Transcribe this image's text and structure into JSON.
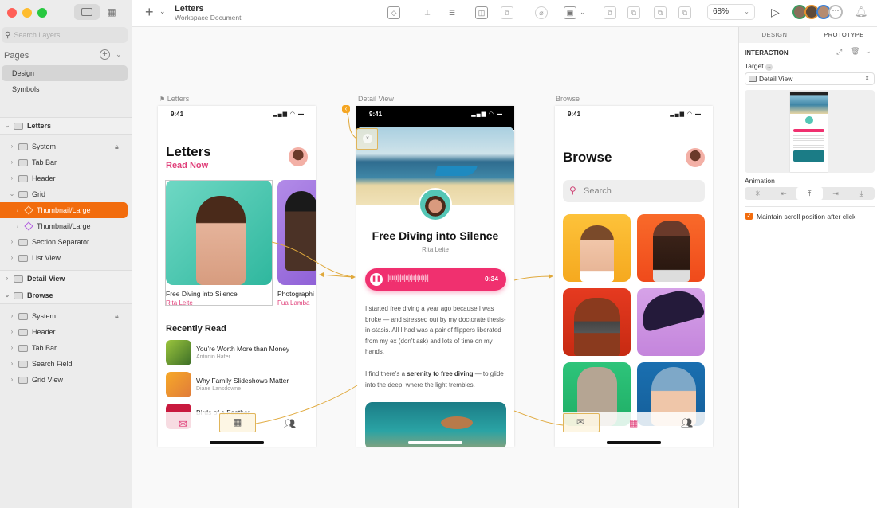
{
  "window": {
    "traffic_colors": [
      "#ff5f57",
      "#febc2e",
      "#28c840"
    ],
    "doc_title": "Letters",
    "doc_subtitle": "Workspace Document"
  },
  "sidebar": {
    "search_placeholder": "Search Layers",
    "pages_label": "Pages",
    "pages": [
      {
        "label": "Design",
        "active": true
      },
      {
        "label": "Symbols",
        "active": false
      }
    ],
    "artboards": [
      {
        "name": "Letters",
        "expanded": true,
        "layers": [
          {
            "label": "System",
            "type": "folder",
            "locked": true
          },
          {
            "label": "Tab Bar",
            "type": "folder"
          },
          {
            "label": "Header",
            "type": "folder"
          },
          {
            "label": "Grid",
            "type": "folder",
            "expanded": true
          },
          {
            "label": "Thumbnail/Large",
            "type": "symbol",
            "selected": true
          },
          {
            "label": "Thumbnail/Large",
            "type": "symbol"
          },
          {
            "label": "Section Separator",
            "type": "folder"
          },
          {
            "label": "List View",
            "type": "folder"
          }
        ]
      },
      {
        "name": "Detail View",
        "expanded": false,
        "layers": []
      },
      {
        "name": "Browse",
        "expanded": true,
        "layers": [
          {
            "label": "System",
            "type": "folder",
            "locked": true
          },
          {
            "label": "Header",
            "type": "folder"
          },
          {
            "label": "Tab Bar",
            "type": "folder"
          },
          {
            "label": "Search Field",
            "type": "folder"
          },
          {
            "label": "Grid View",
            "type": "folder"
          }
        ]
      }
    ]
  },
  "toolbar": {
    "zoom_level": "68%",
    "accent": "#f26c0d"
  },
  "canvas": {
    "letters": {
      "label": "Letters",
      "time": "9:41",
      "title": "Letters",
      "subtitle": "Read Now",
      "cards": [
        {
          "title": "Free Diving into Silence",
          "author": "Rita Leite"
        },
        {
          "title": "Photographi",
          "author": "Fua Lamba"
        }
      ],
      "section": "Recently Read",
      "recent": [
        {
          "title": "You’re Worth More than Money",
          "author": "Antonin Hafer"
        },
        {
          "title": "Why Family Slideshows Matter",
          "author": "Diane Lansdowne"
        },
        {
          "title": "Birds of a Feather",
          "author": ""
        }
      ]
    },
    "detail": {
      "label": "Detail View",
      "time": "9:41",
      "title": "Free Diving into Silence",
      "author": "Rita Leite",
      "audio_time": "0:34",
      "para1": "I started free diving a year ago because I was broke — and stressed out by my doctorate thesis-in-stasis. All I had was a pair of flippers liberated from my ex (don’t ask) and lots of time on my hands.",
      "para2_pre": "I find there’s a ",
      "para2_bold": "serenity to free diving",
      "para2_post": " — to glide into the deep, where the light trembles."
    },
    "browse": {
      "label": "Browse",
      "time": "9:41",
      "title": "Browse",
      "search_placeholder": "Search"
    }
  },
  "inspector": {
    "tabs": [
      "DESIGN",
      "PROTOTYPE"
    ],
    "active_tab": "PROTOTYPE",
    "section": "INTERACTION",
    "target_label": "Target",
    "target_value": "Detail View",
    "animation_label": "Animation",
    "animation_selected_index": 2,
    "checkbox_label": "Maintain scroll position after click",
    "checkbox_checked": true
  }
}
